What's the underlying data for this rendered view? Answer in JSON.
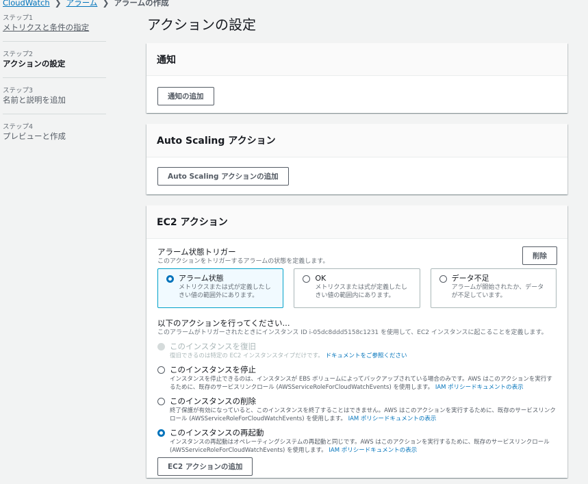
{
  "breadcrumb": {
    "items": [
      "CloudWatch",
      "アラーム"
    ],
    "current": "アラームの作成"
  },
  "steps": [
    {
      "num": "ステップ1",
      "name": "メトリクスと条件の指定"
    },
    {
      "num": "ステップ2",
      "name": "アクションの設定"
    },
    {
      "num": "ステップ3",
      "name": "名前と説明を追加"
    },
    {
      "num": "ステップ4",
      "name": "プレビューと作成"
    }
  ],
  "page_title": "アクションの設定",
  "notification": {
    "title": "通知",
    "add_button": "通知の追加"
  },
  "autoscaling": {
    "title": "Auto Scaling アクション",
    "add_button": "Auto Scaling アクションの追加"
  },
  "ec2": {
    "title": "EC2 アクション",
    "trigger_label": "アラーム状態トリガー",
    "trigger_desc": "このアクションをトリガーするアラームの状態を定義します。",
    "remove_button": "削除",
    "tiles": [
      {
        "label": "アラーム状態",
        "desc": "メトリクスまたは式が定義したしきい値の範囲外にあります。"
      },
      {
        "label": "OK",
        "desc": "メトリクスまたは式が定義したしきい値の範囲内にあります。"
      },
      {
        "label": "データ不足",
        "desc": "アラームが開始されたか、データが不足しています。"
      }
    ],
    "action_label": "以下のアクションを行ってください...",
    "action_desc": "このアラームがトリガーされたときにインスタンス ID i-05dc8ddd5158c1231 を使用して、EC2 インスタンスに起こることを定義します。",
    "options": [
      {
        "label": "このインスタンスを復旧",
        "desc": "復旧できるのは特定の EC2 インスタンスタイプだけです。",
        "link": "ドキュメントをご参照ください"
      },
      {
        "label": "このインスタンスを停止",
        "desc": "インスタンスを停止できるのは、インスタンスが EBS ボリュームによってバックアップされている場合のみです。AWS はこのアクションを実行するために、既存のサービスリンクロール (AWSServiceRoleForCloudWatchEvents) を使用します。",
        "link": "IAM ポリシードキュメントの表示"
      },
      {
        "label": "このインスタンスの削除",
        "desc": "終了保護が有効になっていると、このインスタンスを終了することはできません。AWS はこのアクションを実行するために、既存のサービスリンクロール (AWSServiceRoleForCloudWatchEvents) を使用します。",
        "link": "IAM ポリシードキュメントの表示"
      },
      {
        "label": "このインスタンスの再起動",
        "desc": "インスタンスの再起動はオペレーティングシステムの再起動と同じです。AWS はこのアクションを実行するために、既存のサービスリンクロール (AWSServiceRoleForCloudWatchEvents) を使用します。",
        "link": "IAM ポリシードキュメントの表示"
      }
    ],
    "add_button": "EC2 アクションの追加"
  }
}
